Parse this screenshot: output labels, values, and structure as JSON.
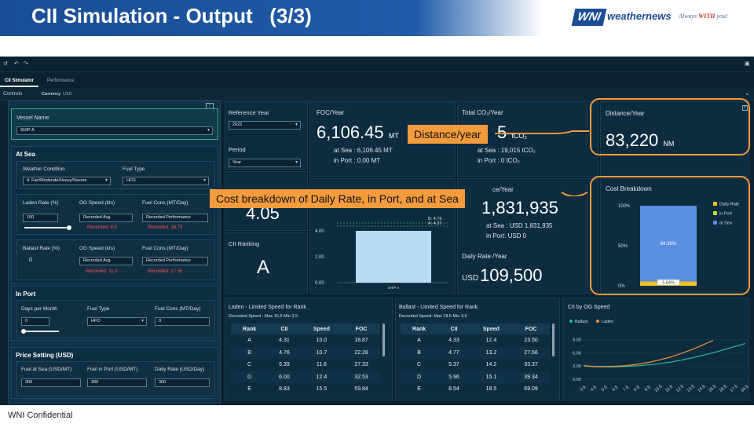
{
  "slide": {
    "title": "CII Simulation - Output   (3/3)",
    "footer": "WNI Confidential"
  },
  "logo": {
    "mark": "WNI",
    "name": "weathernews",
    "tag_prefix": "Always ",
    "tag_bold": "WITH",
    "tag_suffix": " you!"
  },
  "toolbar": {
    "undo": "↺",
    "back": "↶",
    "forward": "↷",
    "menu": "▣"
  },
  "tabs": [
    "CII Simulator",
    "Performance"
  ],
  "controls": {
    "label": "Controls",
    "currency_label": "Currency",
    "currency_value": "USD"
  },
  "vessel": {
    "label": "Vessel Name",
    "value": "SHIP A"
  },
  "at_sea": {
    "title": "At Sea",
    "weather_label": "Weather Condition",
    "weather_value": "4. Fair/Moderate/Heavy/Severe",
    "fuel_label": "Fuel Type",
    "fuel_value": "HFO",
    "laden_label": "Laden Rate (%)",
    "laden_value": "100",
    "og_label": "OG Speed (kts)",
    "og_value": "Recorded Avg.",
    "og_recorded": "Recorded: 9.5",
    "fc_label": "Fuel Cons (MT/Day)",
    "fc_value": "Recorded Performance",
    "fc_recorded": "Recorded: 16.73",
    "ballast_label": "Ballast Rate (%)",
    "ballast_value": "0",
    "og2_label": "OG Speed (kts)",
    "og2_value": "Recorded Avg.",
    "og2_recorded": "Recorded: 11.0",
    "fc2_label": "Fuel Cons (MT/Day)",
    "fc2_value": "Recorded Performance",
    "fc2_recorded": "Recorded: 17.55"
  },
  "in_port": {
    "title": "In Port",
    "days_label": "Days per Month",
    "days_value": "0",
    "fuel_label": "Fuel Type",
    "fuel_value": "HFO",
    "fc_label": "Fuel Cons (MT/Day)",
    "fc_value": "0"
  },
  "price": {
    "title": "Price Setting (USD)",
    "sea_label": "Fuel at Sea (USD/MT)",
    "sea_value": "300",
    "port_label": "Fuel in Port (USD/MT)",
    "port_value": "300",
    "daily_label": "Daily Rate (USD/Day)",
    "daily_value": "300"
  },
  "ref": {
    "label": "Reference Year",
    "value": "2022",
    "period_label": "Period",
    "period_value": "Year"
  },
  "cii_rating": {
    "value": "4.05"
  },
  "cii_ranking": {
    "label": "CII Ranking",
    "value": "A"
  },
  "foc": {
    "label": "FOC/Year",
    "value": "6,106.45",
    "unit": "MT",
    "at_sea": "at Sea : 6,106.45 MT",
    "in_port": "in Port : 0.00 MT"
  },
  "co2": {
    "label": "Total CO₂/Year",
    "value_tail": "5",
    "unit": "tCO₂",
    "at_sea": "at Sea : 19,015 tCO₂",
    "in_port": "in Port : 0 tCO₂"
  },
  "cost": {
    "label_tail": "ce/Year",
    "value_tail": "1,831,935",
    "at_sea": "at Sea : USD 1,831,935",
    "in_port": "in Port: USD 0",
    "daily_label": "Daily Rate /Year",
    "daily_currency": "USD",
    "daily_value": "109,500"
  },
  "distance": {
    "label": "Distance/Year",
    "value": "83,220",
    "unit": "NM"
  },
  "cost_breakdown": {
    "label": "Cost Breakdown"
  },
  "laden_table": {
    "title": "Laden - Limited Speed for Rank",
    "subtitle": "Recorded Speed : Max 15.5    Min 3.5",
    "headers": [
      "Rank",
      "CII",
      "Speed",
      "FOC"
    ],
    "rows": [
      [
        "A",
        "4.31",
        "10.0",
        "18.87"
      ],
      [
        "B",
        "4.76",
        "10.7",
        "22.28"
      ],
      [
        "C",
        "5.39",
        "11.6",
        "27.33"
      ],
      [
        "D",
        "6.00",
        "12.4",
        "32.53"
      ],
      [
        "E",
        "8.83",
        "15.5",
        "59.84"
      ]
    ]
  },
  "ballast_table": {
    "title": "Ballast - Limited Speed for Rank",
    "subtitle": "Recorded Speed: Max 18.5      Min 3.5",
    "headers": [
      "Rank",
      "CII",
      "Speed",
      "FOC"
    ],
    "rows": [
      [
        "A",
        "4.33",
        "12.4",
        "23.50"
      ],
      [
        "B",
        "4.77",
        "13.2",
        "27.56"
      ],
      [
        "C",
        "5.37",
        "14.2",
        "33.37"
      ],
      [
        "D",
        "5.96",
        "15.1",
        "39.34"
      ],
      [
        "E",
        "8.54",
        "18.5",
        "69.09"
      ]
    ]
  },
  "callouts": {
    "distance": "Distance/year",
    "cost": "Cost breakdown of Daily Rate, in Port, and at Sea"
  },
  "chart_data": [
    {
      "type": "bar",
      "categories": [
        "SHIP A"
      ],
      "values": [
        4.05
      ],
      "ylim": [
        0,
        4.0
      ],
      "yticks": [
        "0.00",
        "2.00",
        "4.00"
      ],
      "annotations": [
        "B: 4.78",
        "A: 4.37"
      ]
    },
    {
      "type": "bar",
      "stacked": true,
      "title": "Cost Breakdown",
      "yticks": [
        "0%",
        "50%",
        "100%"
      ],
      "series": [
        {
          "name": "Daily Rate",
          "values": [
            5.64
          ],
          "color": "#f2c12e"
        },
        {
          "name": "in Port",
          "values": [
            0
          ],
          "color": "#b7e03a"
        },
        {
          "name": "at Sea",
          "values": [
            94.36
          ],
          "color": "#5b8fe0"
        }
      ],
      "labels": [
        "94.36%",
        "5.64%"
      ]
    },
    {
      "type": "line",
      "title": "CII by OG Speed",
      "x": [
        3.5,
        4.5,
        5.5,
        6.5,
        7.5,
        8.5,
        9.5,
        10.5,
        11.5,
        12.5,
        13.5,
        14.5,
        15.5,
        16.5,
        17.5,
        18.5
      ],
      "yticks": [
        "0.00",
        "3.00",
        "6.00",
        "9.00"
      ],
      "ylim": [
        0,
        10.5
      ],
      "series": [
        {
          "name": "Ballast",
          "color": "#2bb5a0",
          "values": [
            3.0,
            2.85,
            2.8,
            2.82,
            2.9,
            3.05,
            3.25,
            3.5,
            3.85,
            4.3,
            4.8,
            5.4,
            6.0,
            6.7,
            7.4,
            8.1
          ]
        },
        {
          "name": "Laden",
          "color": "#f3913a",
          "values": [
            3.1,
            2.9,
            2.88,
            2.95,
            3.1,
            3.4,
            3.8,
            4.35,
            5.0,
            5.8,
            6.7,
            7.7,
            8.8
          ]
        }
      ]
    }
  ]
}
